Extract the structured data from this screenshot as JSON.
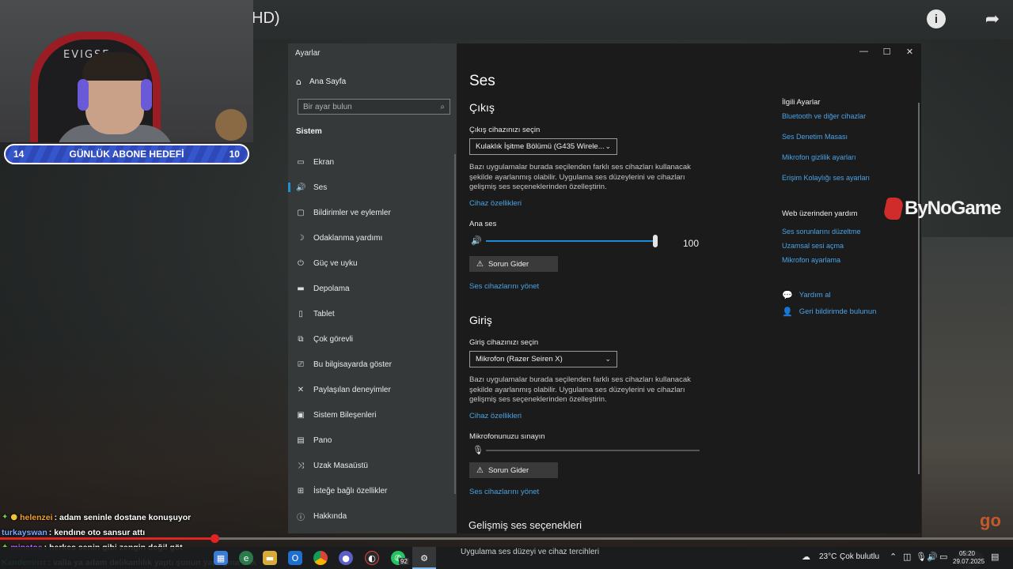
{
  "stream": {
    "title_fragment": "HD)",
    "goal": {
      "left": "14",
      "label": "GÜNLÜK ABONE HEDEFİ",
      "right": "10"
    },
    "webcam_chair_logo": "EVIGSE",
    "watermark": "ByNoGame",
    "corner_mark": "go",
    "progress": 0.212,
    "chat": [
      {
        "user": "helenzei",
        "text": ": adam seninle dostane konuşuyor",
        "user_color": "#f0a030",
        "badges": [
          "sub",
          "gold"
        ]
      },
      {
        "user": "turkayswan",
        "text": ": kendıne oto sansur attı",
        "user_color": "#7aa9ff",
        "badges": []
      },
      {
        "user": "minatoe",
        "text": ": herkes senin gibi zengin değil göt",
        "user_color": "#c36bff",
        "badges": [
          "sub"
        ]
      },
      {
        "user": "Kandemirrr",
        "text": ": valla ya adam delikanlılık yaptı şunun yaptığına bak",
        "user_color": "#7ee0c8",
        "badges": []
      }
    ]
  },
  "window": {
    "title": "Ayarlar",
    "controls": {
      "minimize": "—",
      "maximize": "☐",
      "close": "✕"
    },
    "home_label": "Ana Sayfa",
    "search_placeholder": "Bir ayar bulun",
    "section_label": "Sistem",
    "nav": [
      {
        "icon": "display-icon",
        "glyph": "▭",
        "label": "Ekran",
        "active": false
      },
      {
        "icon": "sound-icon",
        "glyph": "🔊",
        "label": "Ses",
        "active": true
      },
      {
        "icon": "notifications-icon",
        "glyph": "▢",
        "label": "Bildirimler ve eylemler",
        "active": false
      },
      {
        "icon": "focus-assist-icon",
        "glyph": "☽",
        "label": "Odaklanma yardımı",
        "active": false
      },
      {
        "icon": "power-icon",
        "glyph": "⏻",
        "label": "Güç ve uyku",
        "active": false
      },
      {
        "icon": "storage-icon",
        "glyph": "▬",
        "label": "Depolama",
        "active": false
      },
      {
        "icon": "tablet-icon",
        "glyph": "▯",
        "label": "Tablet",
        "active": false
      },
      {
        "icon": "multitasking-icon",
        "glyph": "⧉",
        "label": "Çok görevli",
        "active": false
      },
      {
        "icon": "projecting-icon",
        "glyph": "⎚",
        "label": "Bu bilgisayarda göster",
        "active": false
      },
      {
        "icon": "shared-experiences-icon",
        "glyph": "✕",
        "label": "Paylaşılan deneyimler",
        "active": false
      },
      {
        "icon": "system-components-icon",
        "glyph": "▣",
        "label": "Sistem Bileşenleri",
        "active": false
      },
      {
        "icon": "clipboard-icon",
        "glyph": "▤",
        "label": "Pano",
        "active": false
      },
      {
        "icon": "remote-desktop-icon",
        "glyph": "⤨",
        "label": "Uzak Masaüstü",
        "active": false
      },
      {
        "icon": "optional-features-icon",
        "glyph": "⊞",
        "label": "İsteğe bağlı özellikler",
        "active": false
      },
      {
        "icon": "about-icon",
        "glyph": "ⓘ",
        "label": "Hakkında",
        "active": false
      }
    ],
    "page_title": "Ses",
    "output": {
      "heading": "Çıkış",
      "device_label": "Çıkış cihazınızı seçin",
      "device_value": "Kulaklık İşitme Bölümü (G435 Wirele...",
      "description": "Bazı uygulamalar burada seçilenden farklı ses cihazları kullanacak şekilde ayarlanmış olabilir. Uygulama ses düzeylerini ve cihazları gelişmiş ses seçeneklerinden özelleştirin.",
      "device_props_link": "Cihaz özellikleri",
      "volume_label": "Ana ses",
      "volume_value": 100,
      "volume_display": "100",
      "troubleshoot_label": "Sorun Gider",
      "manage_link": "Ses cihazlarını yönet"
    },
    "input": {
      "heading": "Giriş",
      "device_label": "Giriş cihazınızı seçin",
      "device_value": "Mikrofon (Razer Seiren X)",
      "description": "Bazı uygulamalar burada seçilenden farklı ses cihazları kullanacak şekilde ayarlanmış olabilir. Uygulama ses düzeylerini ve cihazları gelişmiş ses seçeneklerinden özelleştirin.",
      "device_props_link": "Cihaz özellikleri",
      "test_label": "Mikrofonunuzu sınayın",
      "troubleshoot_label": "Sorun Gider",
      "manage_link": "Ses cihazlarını yönet"
    },
    "advanced_heading": "Gelişmiş ses seçenekleri",
    "advanced_sub": "Uygulama ses düzeyi ve cihaz tercihleri",
    "related": {
      "heading": "İlgili Ayarlar",
      "links": [
        "Bluetooth ve diğer cihazlar",
        "Ses Denetim Masası",
        "Mikrofon gizlilik ayarları",
        "Erişim Kolaylığı ses ayarları"
      ]
    },
    "web_help": {
      "heading": "Web üzerinden yardım",
      "links": [
        "Ses sorunlarını düzeltme",
        "Uzamsal sesi açma",
        "Mikrofon ayarlama"
      ]
    },
    "help_link": "Yardım al",
    "feedback_link": "Geri bildirimde bulunun"
  },
  "taskbar": {
    "whatsapp_badge": "92",
    "weather_temp": "23°C",
    "weather_text": "Çok bulutlu",
    "time": "05:20",
    "date": "29.07.2025"
  },
  "colors": {
    "accent": "#1f8ad8",
    "link": "#4aa3e6",
    "progress": "#e02424",
    "goal_bar": "#3656cc"
  }
}
